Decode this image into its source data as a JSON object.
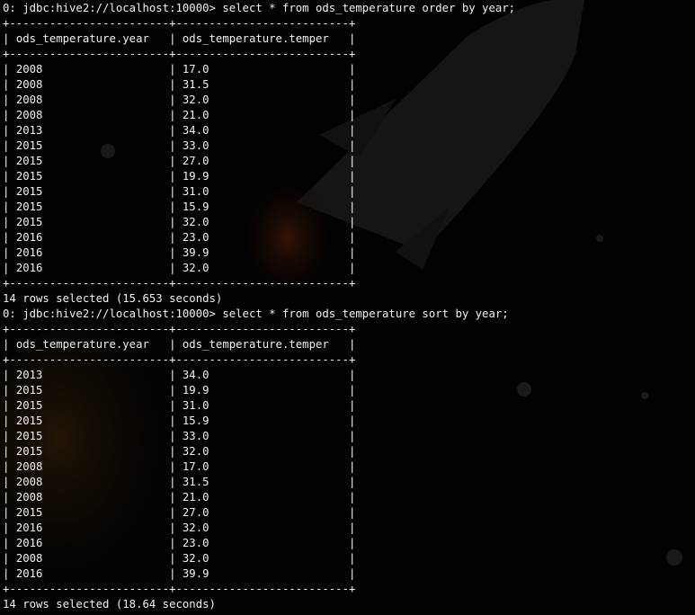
{
  "queries": [
    {
      "prompt": "0: jdbc:hive2://localhost:10000>",
      "command": "select * from ods_temperature order by year;",
      "border": "+------------------------+--------------------------+",
      "headers": [
        "ods_temperature.year",
        "ods_temperature.temper"
      ],
      "rows": [
        [
          "2008",
          "17.0"
        ],
        [
          "2008",
          "31.5"
        ],
        [
          "2008",
          "32.0"
        ],
        [
          "2008",
          "21.0"
        ],
        [
          "2013",
          "34.0"
        ],
        [
          "2015",
          "33.0"
        ],
        [
          "2015",
          "27.0"
        ],
        [
          "2015",
          "19.9"
        ],
        [
          "2015",
          "31.0"
        ],
        [
          "2015",
          "15.9"
        ],
        [
          "2015",
          "32.0"
        ],
        [
          "2016",
          "23.0"
        ],
        [
          "2016",
          "39.9"
        ],
        [
          "2016",
          "32.0"
        ]
      ],
      "summary": "14 rows selected (15.653 seconds)"
    },
    {
      "prompt": "0: jdbc:hive2://localhost:10000>",
      "command": "select * from ods_temperature sort by year;",
      "border": "+------------------------+--------------------------+",
      "headers": [
        "ods_temperature.year",
        "ods_temperature.temper"
      ],
      "rows": [
        [
          "2013",
          "34.0"
        ],
        [
          "2015",
          "19.9"
        ],
        [
          "2015",
          "31.0"
        ],
        [
          "2015",
          "15.9"
        ],
        [
          "2015",
          "33.0"
        ],
        [
          "2015",
          "32.0"
        ],
        [
          "2008",
          "17.0"
        ],
        [
          "2008",
          "31.5"
        ],
        [
          "2008",
          "21.0"
        ],
        [
          "2015",
          "27.0"
        ],
        [
          "2016",
          "32.0"
        ],
        [
          "2016",
          "23.0"
        ],
        [
          "2008",
          "32.0"
        ],
        [
          "2016",
          "39.9"
        ]
      ],
      "summary": "14 rows selected (18.64 seconds)"
    }
  ],
  "colors": {
    "background": "#020202",
    "text": "#f2f2f2"
  }
}
